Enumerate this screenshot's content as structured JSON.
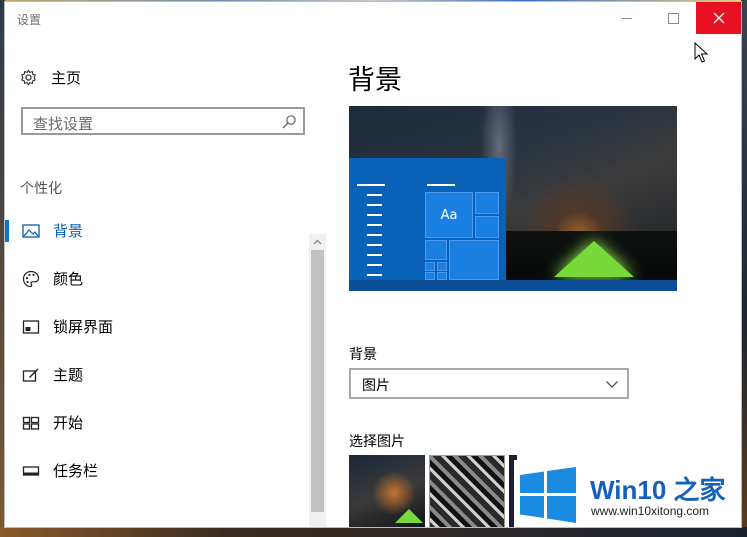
{
  "window": {
    "title": "设置"
  },
  "nav": {
    "home_label": "主页",
    "search_placeholder": "查找设置",
    "section_heading": "个性化",
    "items": [
      {
        "label": "背景",
        "icon": "picture-icon",
        "selected": true
      },
      {
        "label": "颜色",
        "icon": "palette-icon",
        "selected": false
      },
      {
        "label": "锁屏界面",
        "icon": "lock-screen-icon",
        "selected": false
      },
      {
        "label": "主题",
        "icon": "theme-icon",
        "selected": false
      },
      {
        "label": "开始",
        "icon": "start-icon",
        "selected": false
      },
      {
        "label": "任务栏",
        "icon": "taskbar-icon",
        "selected": false
      }
    ]
  },
  "main": {
    "title": "背景",
    "preview": {
      "sample_text": "Aa"
    },
    "background_label": "背景",
    "background_value": "图片",
    "choose_picture_label": "选择图片"
  },
  "watermark": {
    "title": "Win10 之家",
    "url": "www.win10xitong.com"
  },
  "colors": {
    "accent": "#0078d7",
    "close_button": "#e81123",
    "watermark_blue": "#1560bd"
  }
}
